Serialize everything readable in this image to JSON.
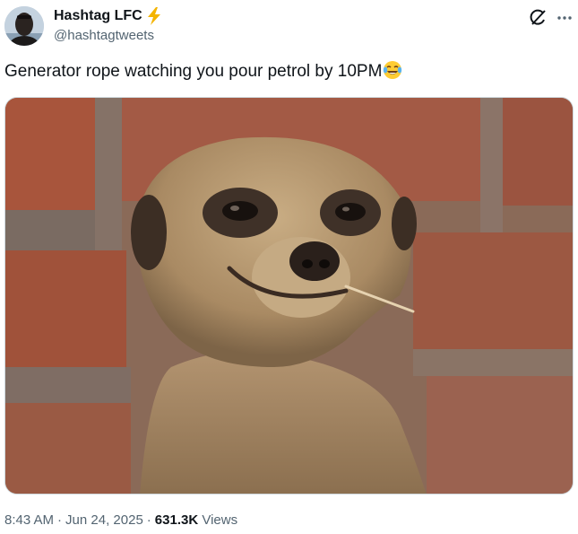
{
  "author": {
    "display_name": "Hashtag LFC",
    "handle": "@hashtagtweets",
    "badge_icon": "lightning-bolt-icon",
    "badge_color": "#f4b400"
  },
  "header_actions": {
    "grok_icon": "grok-icon",
    "more_icon": "more-options-icon"
  },
  "tweet": {
    "text": "Generator rope watching you pour petrol by 10PM",
    "emoji": "face-with-tears-of-joy"
  },
  "media": {
    "subject": "photo-meerkat-against-brick-wall"
  },
  "meta": {
    "time": "8:43 AM",
    "date": "Jun 24, 2025",
    "views_count": "631.3K",
    "views_label": "Views",
    "separator": "·"
  },
  "colors": {
    "text": "#0f1419",
    "secondary": "#536471",
    "border": "#cfd9de"
  }
}
